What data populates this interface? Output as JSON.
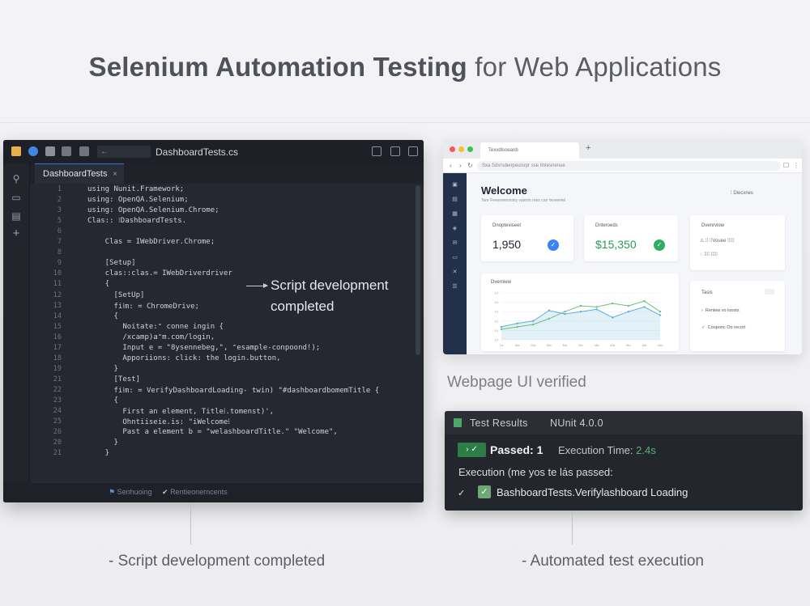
{
  "headline": {
    "bold": "Selenium Automation Testing",
    "rest": "for Web Applications"
  },
  "ide": {
    "titlebar_file": "DashboardTests.cs",
    "search_placeholder": "←",
    "tab_label": "DashboardTests",
    "tab_close": "×",
    "lines": [
      {
        "n": "1",
        "text": "using Nunit.Framework;"
      },
      {
        "n": "2",
        "text": "using: OpenQA.Selenium;"
      },
      {
        "n": "3",
        "text": "using: OpenQA.Selenium.Chrome;"
      },
      {
        "n": "5",
        "text": "Clas:: ⁝DashboardTests."
      },
      {
        "n": "6",
        "text": ""
      },
      {
        "n": "7",
        "text": "    Clas = IWebDriver.Chrome;"
      },
      {
        "n": "8",
        "text": ""
      },
      {
        "n": "9",
        "text": "    [Setup]"
      },
      {
        "n": "10",
        "text": "    clas::clas.= IWebDriverdriver"
      },
      {
        "n": "11",
        "text": "    {"
      },
      {
        "n": "12",
        "text": "      [SetUp]"
      },
      {
        "n": "13",
        "text": "      fi⁞m: = ChromeDrive;"
      },
      {
        "n": "14",
        "text": "      {"
      },
      {
        "n": "15",
        "text": "        Noitate:⁼ conne ingin {"
      },
      {
        "n": "16",
        "text": "        /xcamp)a⁼m.com/login,"
      },
      {
        "n": "17",
        "text": "        Input e = \"8ysennebeg,\", ⁼esample-conpoond!);"
      },
      {
        "n": "18",
        "text": "        Apporiions: click: the login.button,"
      },
      {
        "n": "19",
        "text": "      }"
      },
      {
        "n": "21",
        "text": "      [Test]"
      },
      {
        "n": "22",
        "text": "      fi⁞m: = VerifyDashboardLoading- twin) \"#dashboardbomemTitle {"
      },
      {
        "n": "23",
        "text": "      {"
      },
      {
        "n": "24",
        "text": "        First an element, Title⁞.tomenst)',"
      },
      {
        "n": "25",
        "text": "        Ohntiiseie.is: \"iWelcome⁞"
      },
      {
        "n": "26",
        "text": "        Past a element b = \"welashboardTitle.\" \"Welcome\","
      },
      {
        "n": "20",
        "text": "      }"
      },
      {
        "n": "21",
        "text": "    }"
      }
    ],
    "annotation": "Script development completed",
    "status_left": "Senhuoing",
    "status_right": "Rentieonerncents"
  },
  "browser": {
    "tab_title": "Texvdlsoeanb",
    "url": "Sxa  Sdxrsdenpeuisrpr sse Ilntesnenue",
    "welcome_title": "Welcome",
    "welcome_sub": "Tenr Feesomenniniy vaterm rees coe rkonentel",
    "welcome_right": "⁞ Diecxnes",
    "cards": [
      {
        "label": "Dnopteviseet",
        "value": "1,950",
        "check_color": "#3b82f6"
      },
      {
        "label": "Dnteroeds",
        "value": "$15,350",
        "check_color": "#2fae63"
      }
    ],
    "overview": {
      "title": "Dvenrviow",
      "rows": [
        "⁞⁞ ⁞⁞Vouee ⁞⁞⁞⁞⁞",
        "⁞⁞⁞⁞ ⁞⁞⁞⁞⁞"
      ]
    },
    "chart_title": "Dverniew",
    "tasks": {
      "title": "Tasis",
      "rows": [
        "Renlew vo loosts",
        "Cooponc Oo recort"
      ]
    },
    "chart_data": {
      "type": "line",
      "x": [
        "1a",
        "Ma",
        "Ma",
        "Ma",
        "Ma",
        "Mx",
        "Ma",
        "Ma",
        "Ma",
        "Ma",
        "Ma"
      ],
      "series": [
        {
          "values": [
            22,
            28,
            32,
            50,
            44,
            48,
            52,
            38,
            48,
            56,
            42
          ]
        },
        {
          "values": [
            18,
            22,
            26,
            36,
            48,
            58,
            56,
            62,
            58,
            66,
            48
          ]
        }
      ],
      "ylim": [
        0,
        80
      ],
      "yticks": [
        "10",
        "10",
        "10",
        "10",
        "10",
        "10"
      ]
    },
    "caption": "Webpage UI verified"
  },
  "results": {
    "title": "Test Results",
    "version": "NUnit 4.0.0",
    "passed_badge": "› ✓",
    "passed_text": "Passed: 1",
    "exec_label": "Execution Time:",
    "exec_value": "2.4s",
    "exec_line": "Execution (me yos te lás passed:",
    "test_name": "BashboardTests.Verifylashboard Loading",
    "colors": {
      "pass": "#2f7d46",
      "time": "#58b37a"
    }
  },
  "captions": {
    "left": "- Script development completed",
    "right": "- Automated test execution"
  }
}
